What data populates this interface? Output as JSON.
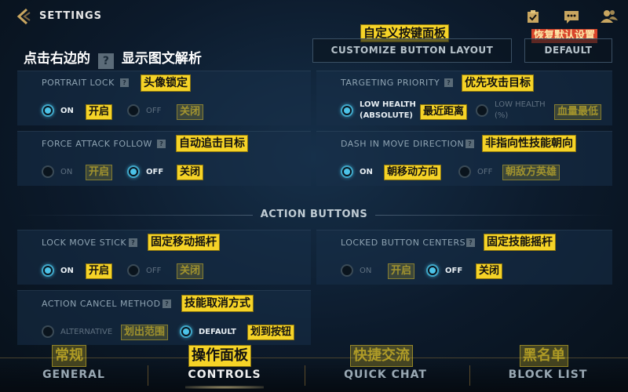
{
  "header": {
    "title": "SETTINGS",
    "hint": "点击右边的",
    "hint_icon": "?",
    "hint_suffix": "显示图文解析"
  },
  "top_buttons": {
    "customize_label": "CUSTOMIZE BUTTON LAYOUT",
    "customize_ann": "自定义按键面板",
    "default_label": "DEFAULT",
    "default_ann": "恢复默认设置"
  },
  "settings": {
    "portrait_lock": {
      "title": "PORTRAIT LOCK",
      "ann": "头像锁定",
      "on": "ON",
      "on_ann": "开启",
      "off": "OFF",
      "off_ann": "关闭",
      "selected": "on"
    },
    "targeting_priority": {
      "title": "TARGETING PRIORITY",
      "ann": "优先攻击目标",
      "opt1_line1": "LOW HEALTH",
      "opt1_line2": "(ABSOLUTE)",
      "opt1_ann": "最近距离",
      "opt2_line1": "LOW HEALTH",
      "opt2_line2": "(%)",
      "opt2_ann": "血量最低",
      "selected": "opt1"
    },
    "force_attack_follow": {
      "title": "FORCE ATTACK FOLLOW",
      "ann": "自动追击目标",
      "on": "ON",
      "on_ann": "开启",
      "off": "OFF",
      "off_ann": "关闭",
      "selected": "off"
    },
    "dash_in_move_direction": {
      "title": "DASH IN MOVE DIRECTION",
      "ann": "非指向性技能朝向",
      "on": "ON",
      "on_ann": "朝移动方向",
      "off": "OFF",
      "off_ann": "朝敌方英雄",
      "selected": "on"
    },
    "lock_move_stick": {
      "title": "LOCK MOVE STICK",
      "ann": "固定移动摇杆",
      "on": "ON",
      "on_ann": "开启",
      "off": "OFF",
      "off_ann": "关闭",
      "selected": "on"
    },
    "locked_button_centers": {
      "title": "LOCKED BUTTON CENTERS",
      "ann": "固定技能摇杆",
      "on": "ON",
      "on_ann": "开启",
      "off": "OFF",
      "off_ann": "关闭",
      "selected": "off"
    },
    "action_cancel_method": {
      "title": "ACTION CANCEL METHOD",
      "ann": "技能取消方式",
      "opt1": "ALTERNATIVE",
      "opt1_ann": "划出范围",
      "opt2": "DEFAULT",
      "opt2_ann": "划到按钮",
      "selected": "opt2"
    }
  },
  "section_header": "ACTION BUTTONS",
  "help_glyph": "?",
  "nav": {
    "items": [
      {
        "label": "GENERAL",
        "ann": "常规",
        "active": false
      },
      {
        "label": "CONTROLS",
        "ann": "操作面板",
        "active": true
      },
      {
        "label": "QUICK CHAT",
        "ann": "快捷交流",
        "active": false
      },
      {
        "label": "BLOCK LIST",
        "ann": "黑名单",
        "active": false
      }
    ]
  },
  "colors": {
    "annotation": "#f5d327",
    "annotation_alert": "#d8452c",
    "radio_active": "#4cc3e8",
    "background": "#0c1a2b"
  },
  "icons": [
    "back-chevron-icon",
    "clipboard-check-icon",
    "chat-bubble-icon",
    "friends-icon",
    "help-icon"
  ]
}
